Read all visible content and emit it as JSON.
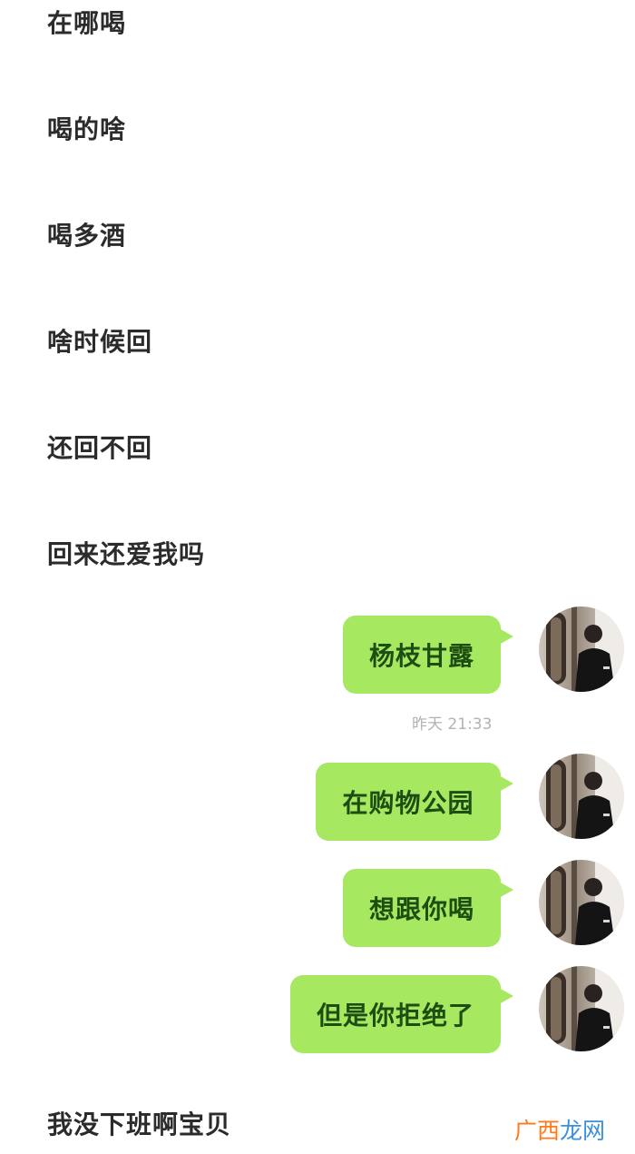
{
  "received_messages": [
    "在哪喝",
    "喝的啥",
    "喝多酒",
    "啥时候回",
    "还回不回",
    "回来还爱我吗"
  ],
  "sent_messages": [
    "杨枝甘露",
    "在购物公园",
    "想跟你喝",
    "但是你拒绝了"
  ],
  "timestamp": "昨天 21:33",
  "last_received_message": "我没下班啊宝贝",
  "watermark": {
    "part1": "广西",
    "part2": "龙网"
  },
  "colors": {
    "sent_bubble": "#a6e860",
    "sent_text": "#1d4d12",
    "received_text": "#2b2b2b",
    "timestamp": "#b2b2b2",
    "watermark_orange": "#ff7a1a",
    "watermark_blue": "#3a8fe0"
  },
  "icons": {
    "avatar": "user-avatar-photo"
  }
}
